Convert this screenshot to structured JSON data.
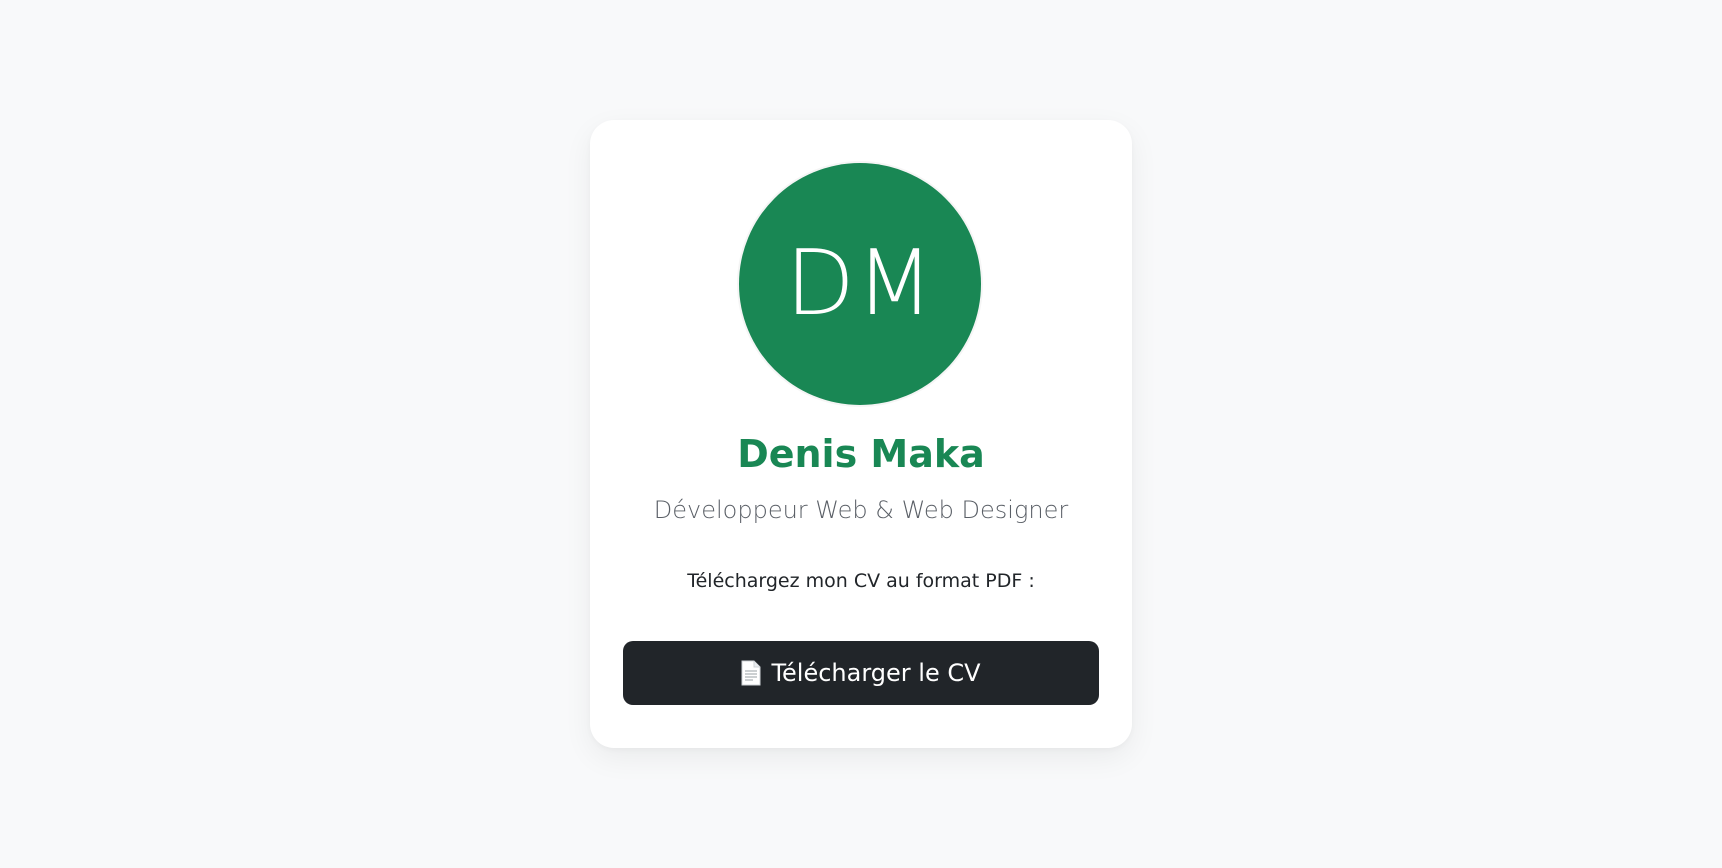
{
  "profile": {
    "initials": "DM",
    "name": "Denis Maka",
    "title": "Développeur Web & Web Designer"
  },
  "cv": {
    "prompt": "Téléchargez mon CV au format PDF :",
    "button_label": "Télécharger le CV",
    "button_icon": "document-icon"
  },
  "colors": {
    "accent": "#198754",
    "button_bg": "#212529",
    "page_bg": "#f8f9fa"
  }
}
